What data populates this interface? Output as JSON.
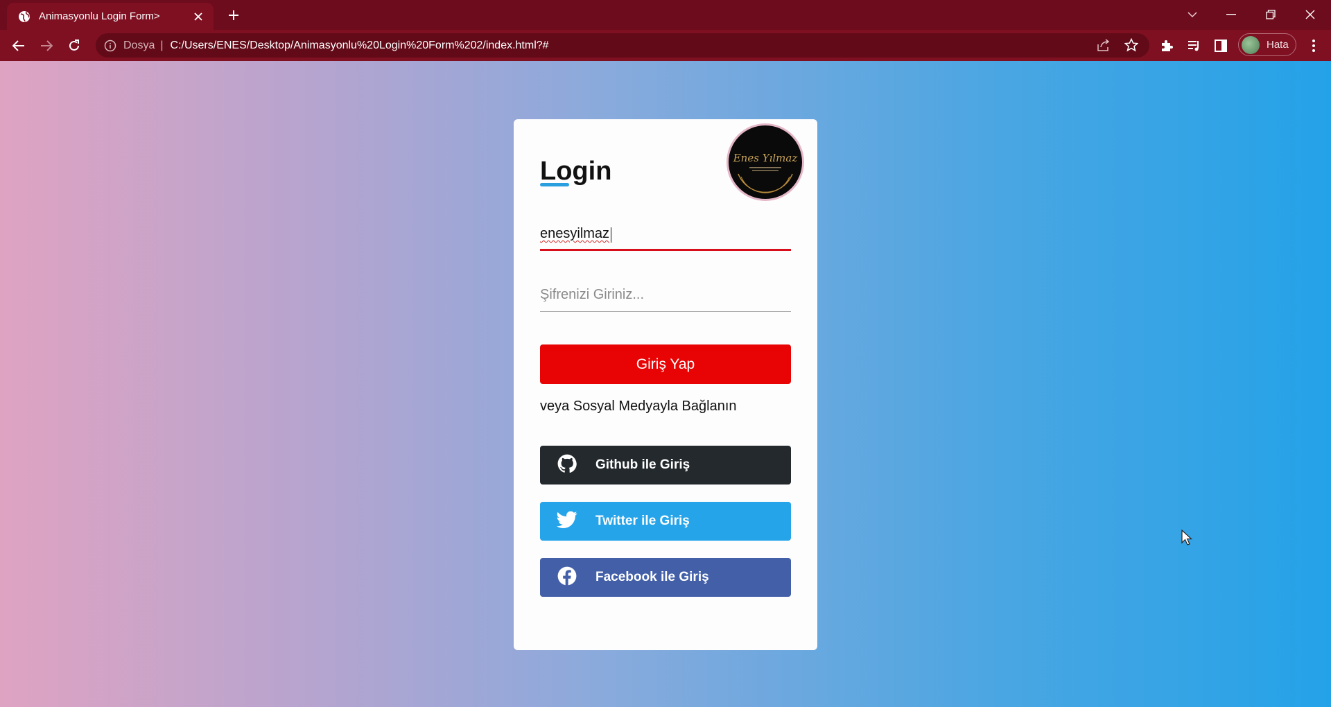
{
  "browser": {
    "tab_title": "Animasyonlu Login Form>",
    "site_label": "Dosya",
    "url": "C:/Users/ENES/Desktop/Animasyonlu%20Login%20Form%202/index.html?#",
    "profile_label": "Hata",
    "theme_color": "#7e1022"
  },
  "form": {
    "title": "Login",
    "logo_text": "Enes Yılmaz",
    "username_value": "enesyilmaz",
    "password_placeholder": "Şifrenizi Giriniz...",
    "submit_label": "Giriş Yap",
    "social_label": "veya Sosyal Medyayla Bağlanın",
    "github_label": "Github ile Giriş",
    "twitter_label": "Twitter ile Giriş",
    "facebook_label": "Facebook ile Giriş"
  },
  "colors": {
    "accent_red": "#e80404",
    "github": "#24292e",
    "twitter": "#26a4e9",
    "facebook": "#425fa8",
    "underline_blue": "#2a9fe0"
  }
}
